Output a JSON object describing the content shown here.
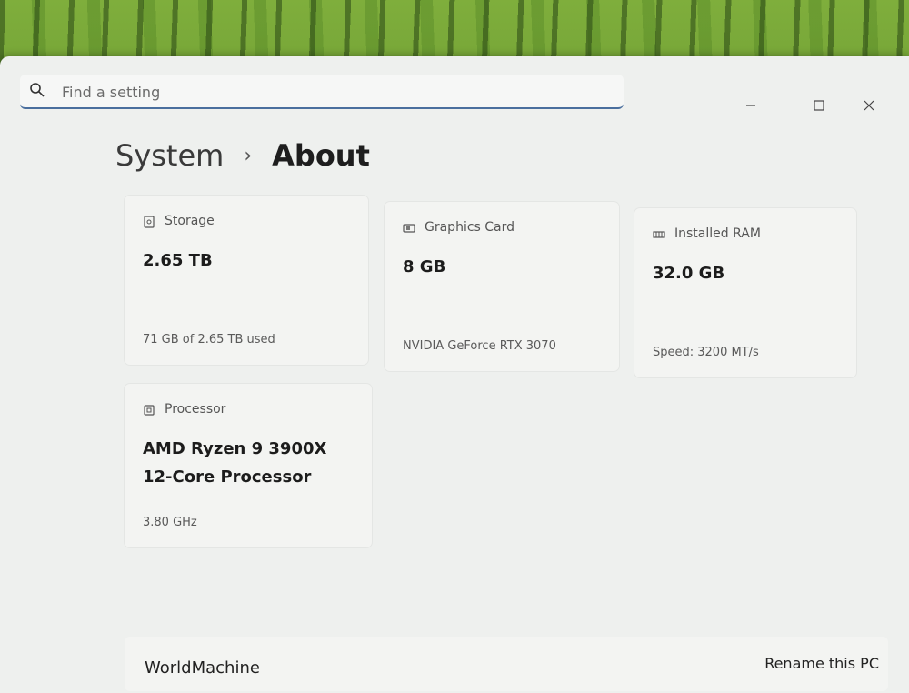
{
  "search": {
    "placeholder": "Find a setting"
  },
  "breadcrumb": {
    "parent": "System",
    "separator": "›",
    "current": "About"
  },
  "cards": {
    "storage": {
      "icon": "storage-icon",
      "label": "Storage",
      "value": "2.65 TB",
      "sub": "71 GB of 2.65 TB used"
    },
    "graphics": {
      "icon": "graphics-card-icon",
      "label": "Graphics Card",
      "value": "8 GB",
      "sub": "NVIDIA GeForce RTX 3070"
    },
    "ram": {
      "icon": "ram-icon",
      "label": "Installed RAM",
      "value": "32.0 GB",
      "sub": "Speed: 3200 MT/s"
    },
    "processor": {
      "icon": "processor-icon",
      "label": "Processor",
      "value_line1": "AMD Ryzen 9 3900X",
      "value_line2": "12-Core Processor",
      "sub": "3.80 GHz"
    }
  },
  "device": {
    "name": "WorldMachine",
    "rename_label": "Rename this PC"
  },
  "colors": {
    "accent": "#4a6f9e",
    "window_bg": "#eef0ee",
    "card_bg": "#f3f4f2"
  }
}
